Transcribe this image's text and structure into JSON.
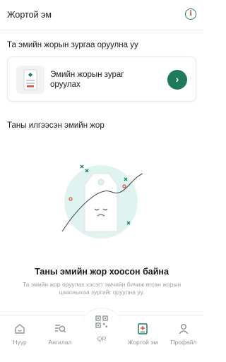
{
  "header": {
    "title": "Жортой эм",
    "info_icon": "info-icon",
    "info_glyph": "i"
  },
  "upload_section": {
    "title": "Та эмийн жорын зургаа оруулна уу",
    "card_label": "Эмийн жорын зураг оруулах",
    "thumb_icon": "prescription-icon",
    "arrow_icon": "chevron-right-icon",
    "arrow_glyph": "›"
  },
  "list_section": {
    "title": "Таны илгээсэн эмийн жор"
  },
  "empty_state": {
    "icon": "sad-prescription-tag-icon",
    "title": "Таны эмийн жор хоосон байна",
    "description": "Та эмийн жор оруулах хэсэгт эмчийн бичиж өгсөн жорын цаасныхаа зургийг оруулна уу."
  },
  "bottom_nav": {
    "items": [
      {
        "label": "Нүүр",
        "icon": "home-icon"
      },
      {
        "label": "Ангилал",
        "icon": "category-search-icon"
      },
      {
        "label": "QR",
        "icon": "qr-code-icon"
      },
      {
        "label": "Жортой эм",
        "icon": "prescription-icon",
        "active": true
      },
      {
        "label": "Профайл",
        "icon": "user-icon"
      }
    ]
  },
  "colors": {
    "accent": "#1e7a58",
    "info_red": "#d94b3a",
    "muted": "#8d9494",
    "illustration_bg": "#dff3f0"
  }
}
